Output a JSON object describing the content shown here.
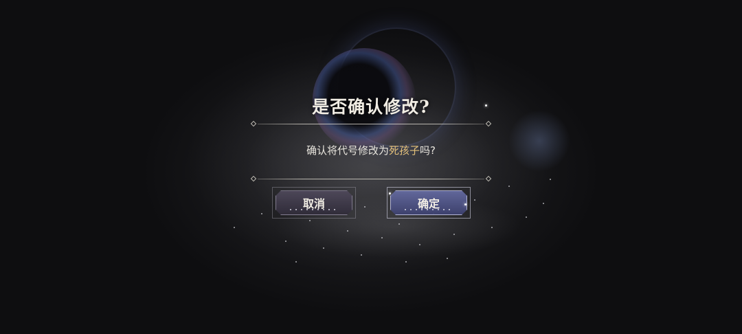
{
  "dialog": {
    "title": "是否确认修改?",
    "message_prefix": "确认将代号修改为",
    "message_name": "死孩子",
    "message_suffix": "吗?",
    "cancel_label": "取消",
    "confirm_label": "确定"
  },
  "colors": {
    "background": "#0d0d0e",
    "title_text": "#f1ede4",
    "body_text": "#e9e6de",
    "highlight_name": "#e6c27a",
    "cancel_button": "#4e485a",
    "confirm_button": "#646aa0"
  },
  "icons": {
    "divider_ornament": "diamond"
  }
}
